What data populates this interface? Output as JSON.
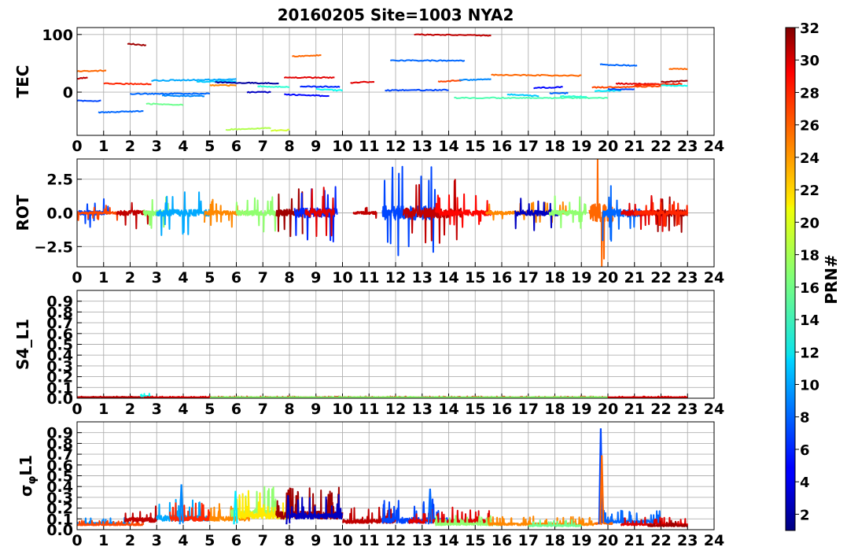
{
  "chart_data": {
    "type": "line",
    "title": "20160205 Site=1003 NYA2",
    "x_ticks": [
      "0",
      "1",
      "2",
      "3",
      "4",
      "5",
      "6",
      "7",
      "8",
      "9",
      "10",
      "11",
      "12",
      "13",
      "14",
      "15",
      "16",
      "17",
      "18",
      "19",
      "20",
      "21",
      "22",
      "23",
      "24"
    ],
    "xlim": [
      0,
      24
    ],
    "grid": true,
    "colormap": "jet",
    "colorbar": {
      "label": "PRN#",
      "range": [
        1,
        32
      ],
      "ticks": [
        "2",
        "4",
        "6",
        "8",
        "10",
        "12",
        "14",
        "16",
        "18",
        "20",
        "22",
        "24",
        "26",
        "28",
        "30",
        "32"
      ]
    },
    "panels": [
      {
        "ylabel": "TEC",
        "ylim": [
          -75,
          112
        ],
        "y_ticks": [
          {
            "v": 100,
            "label": "100"
          },
          {
            "v": 0,
            "label": "0"
          }
        ],
        "arcs": [
          {
            "prn": 30,
            "start": 0.0,
            "end": 0.4,
            "level": 23
          },
          {
            "prn": 25,
            "start": 0.0,
            "end": 1.1,
            "level": 36
          },
          {
            "prn": 7,
            "start": 0.0,
            "end": 0.9,
            "level": -15
          },
          {
            "prn": 27,
            "start": 1.0,
            "end": 2.8,
            "level": 15
          },
          {
            "prn": 31,
            "start": 1.9,
            "end": 2.6,
            "level": 84
          },
          {
            "prn": 8,
            "start": 0.8,
            "end": 2.5,
            "level": -35
          },
          {
            "prn": 8,
            "start": 2.0,
            "end": 5.0,
            "level": -3
          },
          {
            "prn": 9,
            "start": 3.2,
            "end": 4.8,
            "level": -6
          },
          {
            "prn": 16,
            "start": 2.6,
            "end": 4.0,
            "level": -20
          },
          {
            "prn": 10,
            "start": 2.8,
            "end": 6.0,
            "level": 20
          },
          {
            "prn": 11,
            "start": 4.5,
            "end": 6.0,
            "level": 18
          },
          {
            "prn": 24,
            "start": 5.0,
            "end": 6.0,
            "level": 12
          },
          {
            "prn": 2,
            "start": 5.2,
            "end": 7.6,
            "level": 17
          },
          {
            "prn": 18,
            "start": 5.6,
            "end": 7.3,
            "level": -65
          },
          {
            "prn": 19,
            "start": 7.3,
            "end": 8.0,
            "level": -67
          },
          {
            "prn": 3,
            "start": 6.4,
            "end": 7.3,
            "level": 0
          },
          {
            "prn": 14,
            "start": 6.8,
            "end": 8.0,
            "level": 10
          },
          {
            "prn": 5,
            "start": 7.8,
            "end": 9.5,
            "level": -4
          },
          {
            "prn": 25,
            "start": 8.1,
            "end": 9.2,
            "level": 62
          },
          {
            "prn": 29,
            "start": 7.8,
            "end": 9.7,
            "level": 25
          },
          {
            "prn": 6,
            "start": 8.4,
            "end": 9.9,
            "level": 10
          },
          {
            "prn": 13,
            "start": 9.0,
            "end": 10.0,
            "level": 5
          },
          {
            "prn": 29,
            "start": 10.3,
            "end": 11.2,
            "level": 16
          },
          {
            "prn": 7,
            "start": 11.6,
            "end": 14.0,
            "level": 3
          },
          {
            "prn": 8,
            "start": 11.8,
            "end": 14.6,
            "level": 55
          },
          {
            "prn": 30,
            "start": 12.7,
            "end": 15.6,
            "level": 100
          },
          {
            "prn": 26,
            "start": 13.6,
            "end": 14.5,
            "level": 18
          },
          {
            "prn": 9,
            "start": 14.4,
            "end": 15.6,
            "level": 21
          },
          {
            "prn": 15,
            "start": 14.2,
            "end": 20.0,
            "level": -10
          },
          {
            "prn": 25,
            "start": 15.6,
            "end": 19.0,
            "level": 30
          },
          {
            "prn": 11,
            "start": 16.2,
            "end": 17.4,
            "level": -4
          },
          {
            "prn": 5,
            "start": 17.2,
            "end": 18.3,
            "level": 7
          },
          {
            "prn": 8,
            "start": 17.8,
            "end": 18.5,
            "level": -2
          },
          {
            "prn": 14,
            "start": 18.2,
            "end": 19.2,
            "level": -7
          },
          {
            "prn": 8,
            "start": 19.7,
            "end": 21.1,
            "level": 48
          },
          {
            "prn": 26,
            "start": 19.4,
            "end": 22.0,
            "level": 8
          },
          {
            "prn": 12,
            "start": 19.5,
            "end": 20.5,
            "level": 2
          },
          {
            "prn": 7,
            "start": 20.0,
            "end": 21.0,
            "level": 5
          },
          {
            "prn": 29,
            "start": 20.3,
            "end": 22.5,
            "level": 15
          },
          {
            "prn": 27,
            "start": 21.0,
            "end": 22.8,
            "level": 12
          },
          {
            "prn": 31,
            "start": 22.0,
            "end": 23.0,
            "level": 18
          },
          {
            "prn": 25,
            "start": 22.3,
            "end": 23.0,
            "level": 40
          },
          {
            "prn": 13,
            "start": 22.0,
            "end": 23.0,
            "level": 12
          }
        ]
      },
      {
        "ylabel": "ROT",
        "ylim": [
          -4,
          4
        ],
        "y_ticks": [
          {
            "v": 2.5,
            "label": "2.5"
          },
          {
            "v": 0,
            "label": "0.0"
          },
          {
            "v": -2.5,
            "label": "−2.5"
          }
        ],
        "segments": [
          {
            "start": 0.0,
            "end": 1.2,
            "prn": 7,
            "amp": 0.8,
            "seed": 11
          },
          {
            "start": 0.0,
            "end": 1.9,
            "prn": 26,
            "amp": 0.4,
            "seed": 12
          },
          {
            "start": 1.5,
            "end": 2.8,
            "prn": 30,
            "amp": 0.9,
            "seed": 13
          },
          {
            "start": 2.5,
            "end": 3.5,
            "prn": 17,
            "amp": 1.0,
            "seed": 14
          },
          {
            "start": 3.0,
            "end": 5.0,
            "prn": 10,
            "amp": 1.2,
            "seed": 15
          },
          {
            "start": 4.8,
            "end": 6.4,
            "prn": 24,
            "amp": 0.8,
            "seed": 16
          },
          {
            "start": 6.0,
            "end": 7.5,
            "prn": 17,
            "amp": 1.0,
            "seed": 17
          },
          {
            "start": 7.5,
            "end": 8.5,
            "prn": 31,
            "amp": 1.3,
            "seed": 18
          },
          {
            "start": 8.2,
            "end": 9.8,
            "prn": 6,
            "amp": 1.8,
            "seed": 19
          },
          {
            "start": 8.6,
            "end": 9.7,
            "prn": 29,
            "amp": 1.4,
            "seed": 20
          },
          {
            "start": 10.4,
            "end": 11.3,
            "prn": 30,
            "amp": 0.5,
            "seed": 21
          },
          {
            "start": 11.5,
            "end": 13.5,
            "prn": 7,
            "amp": 2.6,
            "seed": 22
          },
          {
            "start": 12.3,
            "end": 14.5,
            "prn": 30,
            "amp": 1.8,
            "seed": 23
          },
          {
            "start": 13.5,
            "end": 15.6,
            "prn": 28,
            "amp": 1.0,
            "seed": 24
          },
          {
            "start": 15.4,
            "end": 18.5,
            "prn": 24,
            "amp": 0.6,
            "seed": 25
          },
          {
            "start": 16.5,
            "end": 18.2,
            "prn": 3,
            "amp": 1.0,
            "seed": 26
          },
          {
            "start": 17.8,
            "end": 19.2,
            "prn": 17,
            "amp": 0.9,
            "seed": 27
          },
          {
            "start": 19.3,
            "end": 20.2,
            "prn": 25,
            "amp": 3.6,
            "seed": 28
          },
          {
            "start": 19.8,
            "end": 21.3,
            "prn": 8,
            "amp": 1.5,
            "seed": 29
          },
          {
            "start": 20.5,
            "end": 22.2,
            "prn": 29,
            "amp": 1.0,
            "seed": 30
          },
          {
            "start": 21.8,
            "end": 23.0,
            "prn": 31,
            "amp": 1.2,
            "seed": 31
          },
          {
            "start": 21.0,
            "end": 23.0,
            "prn": 27,
            "amp": 0.7,
            "seed": 32
          }
        ]
      },
      {
        "ylabel": "S4_L1",
        "ylim": [
          0,
          1
        ],
        "y_ticks": [
          {
            "v": 0,
            "label": "0.0"
          },
          {
            "v": 0.1,
            "label": "0.1"
          },
          {
            "v": 0.2,
            "label": "0.2"
          },
          {
            "v": 0.3,
            "label": "0.3"
          },
          {
            "v": 0.4,
            "label": "0.4"
          },
          {
            "v": 0.5,
            "label": "0.5"
          },
          {
            "v": 0.6,
            "label": "0.6"
          },
          {
            "v": 0.7,
            "label": "0.7"
          },
          {
            "v": 0.8,
            "label": "0.8"
          },
          {
            "v": 0.9,
            "label": "0.9"
          }
        ],
        "segments": [
          {
            "start": 0.0,
            "end": 2.5,
            "prn": 30,
            "base": 0.01,
            "amp": 0.005,
            "seed": 41
          },
          {
            "start": 2.4,
            "end": 2.8,
            "prn": 13,
            "base": 0.015,
            "amp": 0.02,
            "seed": 42
          },
          {
            "start": 2.5,
            "end": 23.0,
            "prn": 29,
            "base": 0.008,
            "amp": 0.006,
            "seed": 43
          },
          {
            "start": 5.0,
            "end": 20.0,
            "prn": 17,
            "base": 0.008,
            "amp": 0.005,
            "seed": 44
          }
        ]
      },
      {
        "ylabel": "σφL1",
        "ylim": [
          0,
          1
        ],
        "y_ticks": [
          {
            "v": 0,
            "label": "0.0"
          },
          {
            "v": 0.1,
            "label": "0.1"
          },
          {
            "v": 0.2,
            "label": "0.2"
          },
          {
            "v": 0.3,
            "label": "0.3"
          },
          {
            "v": 0.4,
            "label": "0.4"
          },
          {
            "v": 0.5,
            "label": "0.5"
          },
          {
            "v": 0.6,
            "label": "0.6"
          },
          {
            "v": 0.7,
            "label": "0.7"
          },
          {
            "v": 0.8,
            "label": "0.8"
          },
          {
            "v": 0.9,
            "label": "0.9"
          }
        ],
        "segments": [
          {
            "start": 0.0,
            "end": 2.0,
            "prn": 9,
            "base": 0.05,
            "amp": 0.04,
            "seed": 51
          },
          {
            "start": 0.0,
            "end": 2.5,
            "prn": 26,
            "base": 0.04,
            "amp": 0.03,
            "seed": 52
          },
          {
            "start": 1.8,
            "end": 3.0,
            "prn": 30,
            "base": 0.07,
            "amp": 0.12,
            "seed": 53
          },
          {
            "start": 3.0,
            "end": 5.0,
            "prn": 10,
            "base": 0.08,
            "amp": 0.15,
            "seed": 54
          },
          {
            "start": 3.5,
            "end": 5.0,
            "prn": 27,
            "base": 0.08,
            "amp": 0.12,
            "seed": 55
          },
          {
            "start": 5.0,
            "end": 6.5,
            "prn": 24,
            "base": 0.08,
            "amp": 0.12,
            "seed": 56
          },
          {
            "start": 5.8,
            "end": 7.5,
            "prn": 17,
            "base": 0.12,
            "amp": 0.2,
            "seed": 57
          },
          {
            "start": 6.0,
            "end": 8.0,
            "prn": 21,
            "base": 0.1,
            "amp": 0.18,
            "seed": 58
          },
          {
            "start": 7.5,
            "end": 10.0,
            "prn": 31,
            "base": 0.1,
            "amp": 0.2,
            "seed": 59
          },
          {
            "start": 8.0,
            "end": 10.0,
            "prn": 3,
            "base": 0.1,
            "amp": 0.15,
            "seed": 60
          },
          {
            "start": 10.0,
            "end": 12.0,
            "prn": 30,
            "base": 0.06,
            "amp": 0.1,
            "seed": 61
          },
          {
            "start": 11.5,
            "end": 14.0,
            "prn": 7,
            "base": 0.06,
            "amp": 0.15,
            "seed": 62
          },
          {
            "start": 12.5,
            "end": 15.6,
            "prn": 29,
            "base": 0.06,
            "amp": 0.1,
            "seed": 63
          },
          {
            "start": 13.5,
            "end": 16.0,
            "prn": 17,
            "base": 0.04,
            "amp": 0.06,
            "seed": 64
          },
          {
            "start": 15.5,
            "end": 19.5,
            "prn": 24,
            "base": 0.04,
            "amp": 0.06,
            "seed": 65
          },
          {
            "start": 17.0,
            "end": 19.0,
            "prn": 16,
            "base": 0.03,
            "amp": 0.04,
            "seed": 66
          },
          {
            "start": 19.5,
            "end": 20.2,
            "prn": 25,
            "base": 0.05,
            "amp": 0.05,
            "seed": 67
          },
          {
            "start": 19.8,
            "end": 22.0,
            "prn": 8,
            "base": 0.06,
            "amp": 0.08,
            "seed": 68
          },
          {
            "start": 20.5,
            "end": 23.0,
            "prn": 29,
            "base": 0.04,
            "amp": 0.05,
            "seed": 69
          },
          {
            "start": 21.5,
            "end": 23.0,
            "prn": 31,
            "base": 0.03,
            "amp": 0.04,
            "seed": 70
          }
        ],
        "spikes": [
          {
            "x": 3.93,
            "prn": 9,
            "y": 0.42
          },
          {
            "x": 5.97,
            "prn": 12,
            "y": 0.36
          },
          {
            "x": 7.95,
            "prn": 3,
            "y": 0.32
          },
          {
            "x": 13.3,
            "prn": 8,
            "y": 0.38
          },
          {
            "x": 19.73,
            "prn": 7,
            "y": 0.94
          },
          {
            "x": 19.77,
            "prn": 25,
            "y": 0.69
          }
        ]
      }
    ]
  }
}
